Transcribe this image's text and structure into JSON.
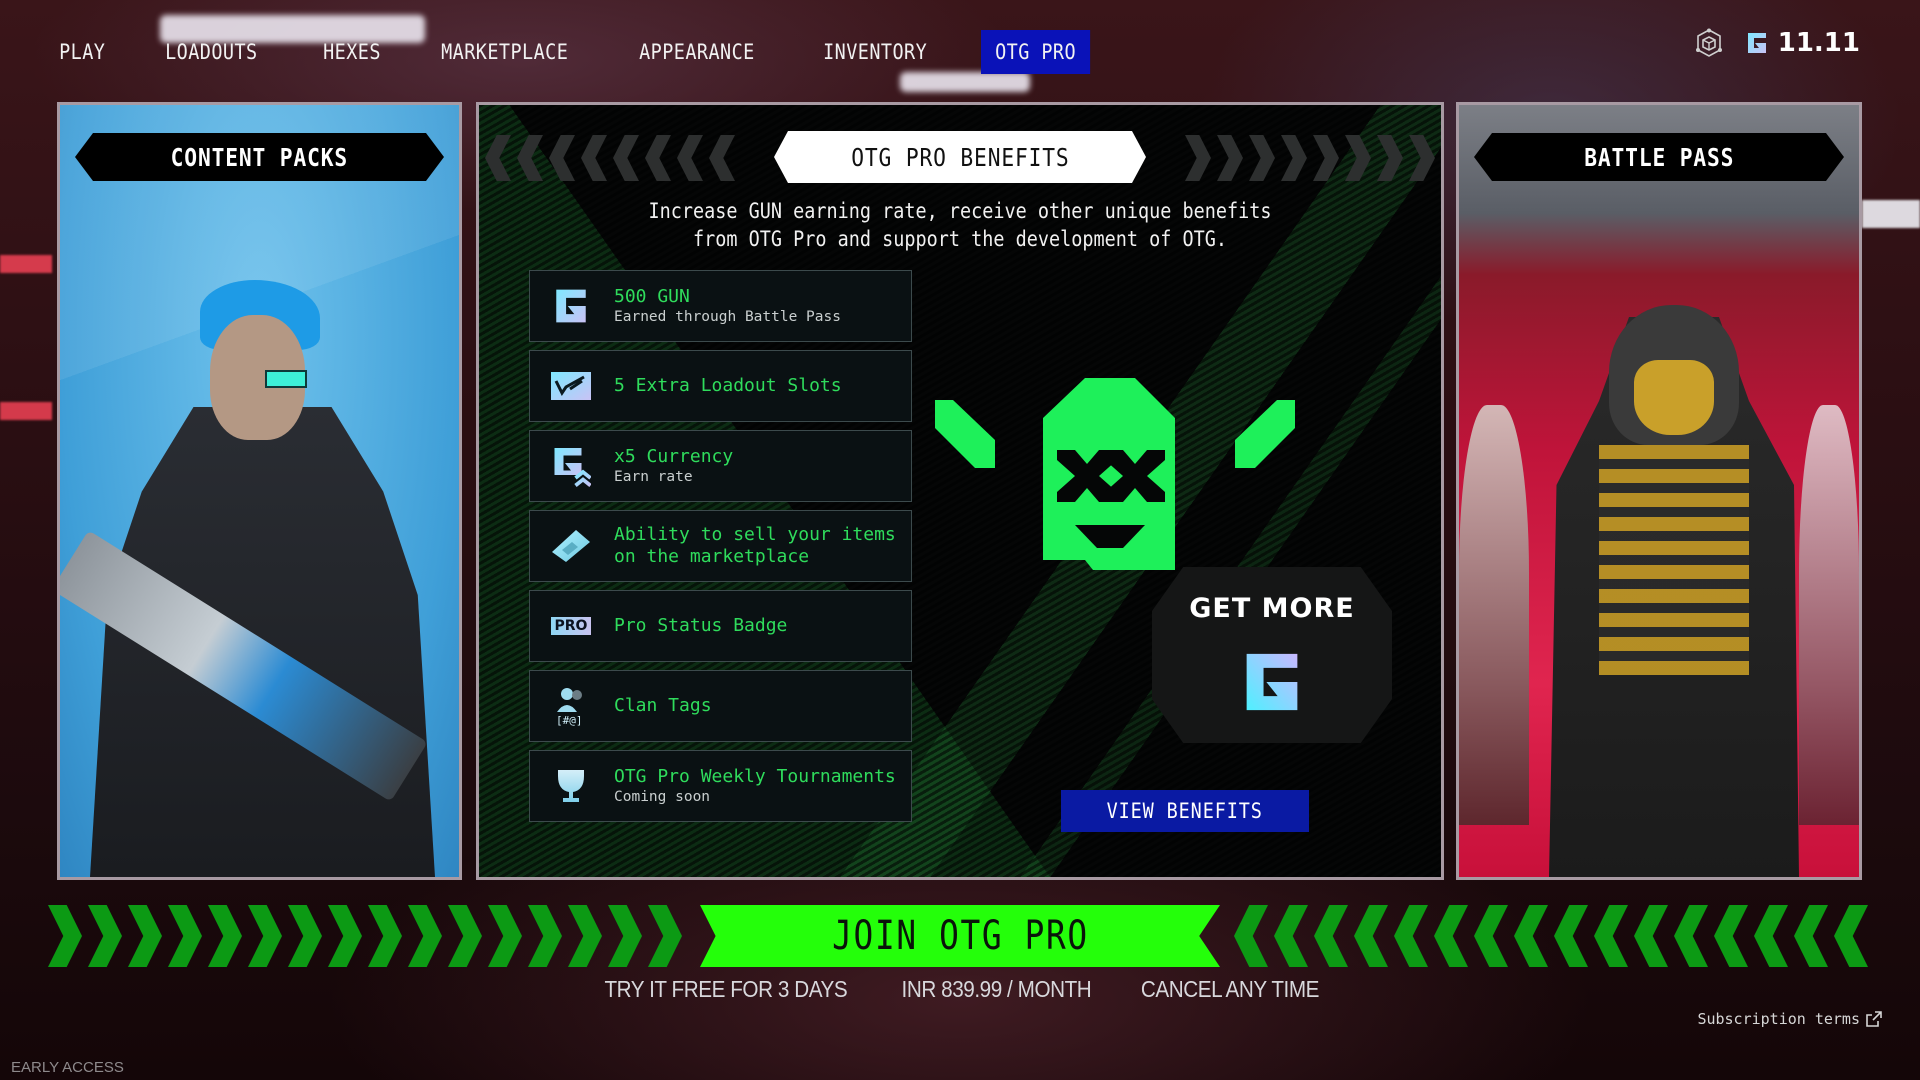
{
  "nav": {
    "items": [
      {
        "label": "PLAY",
        "active": false
      },
      {
        "label": "LOADOUTS",
        "active": false
      },
      {
        "label": "HEXES",
        "active": false
      },
      {
        "label": "MARKETPLACE",
        "active": false
      },
      {
        "label": "APPEARANCE",
        "active": false
      },
      {
        "label": "INVENTORY",
        "active": false
      },
      {
        "label": "OTG PRO",
        "active": true
      }
    ]
  },
  "header": {
    "hub_icon": "hex-cube-icon",
    "currency_icon": "gun-token-icon",
    "currency_value": "11.11"
  },
  "left_panel": {
    "title": "CONTENT PACKS"
  },
  "right_panel": {
    "title": "BATTLE PASS"
  },
  "center_panel": {
    "title": "OTG PRO BENEFITS",
    "intro_line1": "Increase GUN earning rate, receive other unique benefits",
    "intro_line2": "from OTG Pro and support the development of OTG.",
    "benefits": [
      {
        "icon": "gun-token-icon",
        "title": "500 GUN",
        "subtitle": "Earned through Battle Pass"
      },
      {
        "icon": "loadout-slot-icon",
        "title": "5 Extra Loadout Slots",
        "subtitle": ""
      },
      {
        "icon": "currency-multiplier-icon",
        "title": "x5 Currency",
        "subtitle": "Earn rate"
      },
      {
        "icon": "sell-item-icon",
        "title": "Ability to sell your items on the marketplace",
        "subtitle": ""
      },
      {
        "icon": "pro-badge-icon",
        "title": "Pro Status Badge",
        "subtitle": "",
        "badge_text": "PRO"
      },
      {
        "icon": "clan-tags-icon",
        "title": "Clan Tags",
        "subtitle": "",
        "tag_text": "[#@]"
      },
      {
        "icon": "trophy-icon",
        "title": "OTG Pro Weekly Tournaments",
        "subtitle": "Coming soon"
      }
    ],
    "get_more_label": "GET MORE",
    "view_benefits_label": "VIEW BENEFITS"
  },
  "join": {
    "button_label": "JOIN OTG PRO",
    "trial_text": "TRY IT FREE FOR 3 DAYS",
    "price_text": "INR 839.99 / MONTH",
    "cancel_text": "CANCEL ANY TIME",
    "subscription_terms_label": "Subscription terms"
  },
  "footer": {
    "build_label": "EARLY ACCESS"
  },
  "colors": {
    "accent_green": "#24ff0a",
    "benefit_green": "#2fdc5c",
    "active_tab_blue": "#0a12b8",
    "button_blue": "#0a1aa3",
    "mascot_green": "#1ef05a"
  }
}
